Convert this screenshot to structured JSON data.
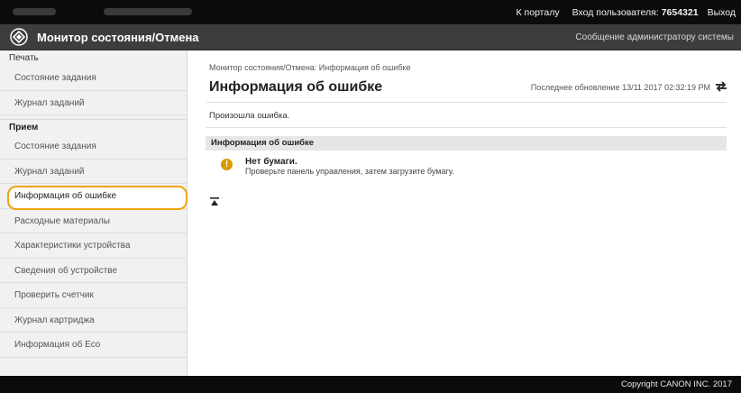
{
  "topbar": {
    "portal_link": "К порталу",
    "login_label": "Вход пользователя:",
    "user_id": "7654321",
    "logout_link": "Выход"
  },
  "titlebar": {
    "app_title": "Монитор состояния/Отмена",
    "admin_message_link": "Сообщение администратору системы"
  },
  "sidebar": {
    "print_section": "Печать",
    "print_items": [
      {
        "label": "Состояние задания"
      },
      {
        "label": "Журнал заданий"
      }
    ],
    "receive_section": "Прием",
    "items": [
      {
        "label": "Состояние задания"
      },
      {
        "label": "Журнал заданий"
      },
      {
        "label": "Информация об ошибке",
        "active": true
      },
      {
        "label": "Расходные материалы"
      },
      {
        "label": "Характеристики устройства"
      },
      {
        "label": "Сведения об устройстве"
      },
      {
        "label": "Проверить счетчик"
      },
      {
        "label": "Журнал картриджа"
      },
      {
        "label": "Информация об Eco"
      }
    ]
  },
  "main": {
    "breadcrumb": "Монитор состояния/Отмена: Информация об ошибке",
    "title": "Информация об ошибке",
    "last_update": "Последнее обновление 13/11 2017 02:32:19 PM",
    "notice": "Произошла ошибка.",
    "info_header": "Информация об ошибке",
    "error": {
      "title": "Нет бумаги.",
      "description": "Проверьте панель управления, затем загрузите бумагу."
    }
  },
  "footer": {
    "copyright": "Copyright CANON INC. 2017"
  },
  "colors": {
    "highlight": "#f0a30a",
    "warning_icon": "#d99a00",
    "titlebar_bg": "#3d3d3d",
    "topbar_bg": "#0b0b0b"
  },
  "icons": {
    "logo": "canon-diamond-icon",
    "refresh": "refresh-arrows-icon",
    "error": "warning-icon",
    "top": "page-top-icon"
  }
}
